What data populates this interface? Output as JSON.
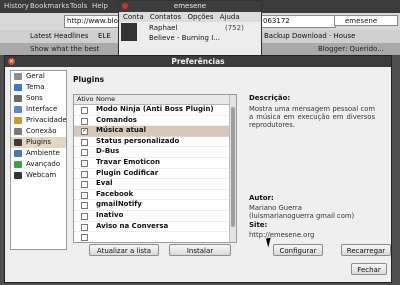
{
  "browser": {
    "menus": [
      "History",
      "Bookmarks",
      "Tools",
      "Help"
    ],
    "url": "http://www.blogg",
    "url_right": "063172",
    "search_value": "emesene",
    "bookmarks": [
      "Latest Headlines",
      "ELE",
      "Backup",
      "Download · House"
    ],
    "tabs": [
      "Show what the best",
      "Blogger: Querido..."
    ]
  },
  "emesene": {
    "title": "emesene",
    "menus": [
      "Conta",
      "Contatos",
      "Opções",
      "Ajuda"
    ],
    "contact_name": "Raphael",
    "count": "(752)",
    "status": "Believe - Burning I..."
  },
  "dialog": {
    "title": "Preferências",
    "sidebar": [
      {
        "label": "Geral",
        "icon": "gear-icon",
        "color": "#8a8f98"
      },
      {
        "label": "Tema",
        "icon": "theme-icon",
        "color": "#3a78c8"
      },
      {
        "label": "Sons",
        "icon": "speaker-icon",
        "color": "#666666"
      },
      {
        "label": "Interface",
        "icon": "interface-icon",
        "color": "#5a88c8"
      },
      {
        "label": "Privacidade",
        "icon": "lock-icon",
        "color": "#c89a30"
      },
      {
        "label": "Conexão",
        "icon": "network-icon",
        "color": "#7a7a7a"
      },
      {
        "label": "Plugins",
        "icon": "plugin-icon",
        "color": "#3c3c3c",
        "selected": true
      },
      {
        "label": "Ambiente",
        "icon": "desktop-icon",
        "color": "#4a78a8"
      },
      {
        "label": "Avançado",
        "icon": "advanced-icon",
        "color": "#40a040"
      },
      {
        "label": "Webcam",
        "icon": "webcam-icon",
        "color": "#333333"
      }
    ],
    "plugins_heading": "Plugins",
    "columns": {
      "active": "Ativo",
      "name": "Nome"
    },
    "plugins": [
      {
        "name": "Modo Ninja (Anti Boss Plugin)",
        "active": false
      },
      {
        "name": "Comandos",
        "active": false
      },
      {
        "name": "Música atual",
        "active": true,
        "selected": true
      },
      {
        "name": "Status personalizado",
        "active": false
      },
      {
        "name": "D-Bus",
        "active": false
      },
      {
        "name": "Travar Emoticon",
        "active": false
      },
      {
        "name": "Plugin Codificar",
        "active": false
      },
      {
        "name": "Eval",
        "active": false
      },
      {
        "name": "Facebook",
        "active": false
      },
      {
        "name": "gmailNotify",
        "active": false
      },
      {
        "name": "Inativo",
        "active": false
      },
      {
        "name": "Aviso na Conversa",
        "active": false
      },
      {
        "name": "",
        "active": false
      }
    ],
    "description_label": "Descrição:",
    "description": "Mostra uma mensagem pessoal com a música em execução em diversos reprodutores.",
    "author_label": "Autor:",
    "author_name": "Mariano Guerra",
    "author_email": "(luismarianoguerra gmail com)",
    "site_label": "Site:",
    "site_url": "http://emesene.org",
    "buttons": {
      "update": "Atualizar a lista",
      "install": "Instalar",
      "configure": "Configurar",
      "reload": "Recarregar",
      "close": "Fechar"
    }
  }
}
